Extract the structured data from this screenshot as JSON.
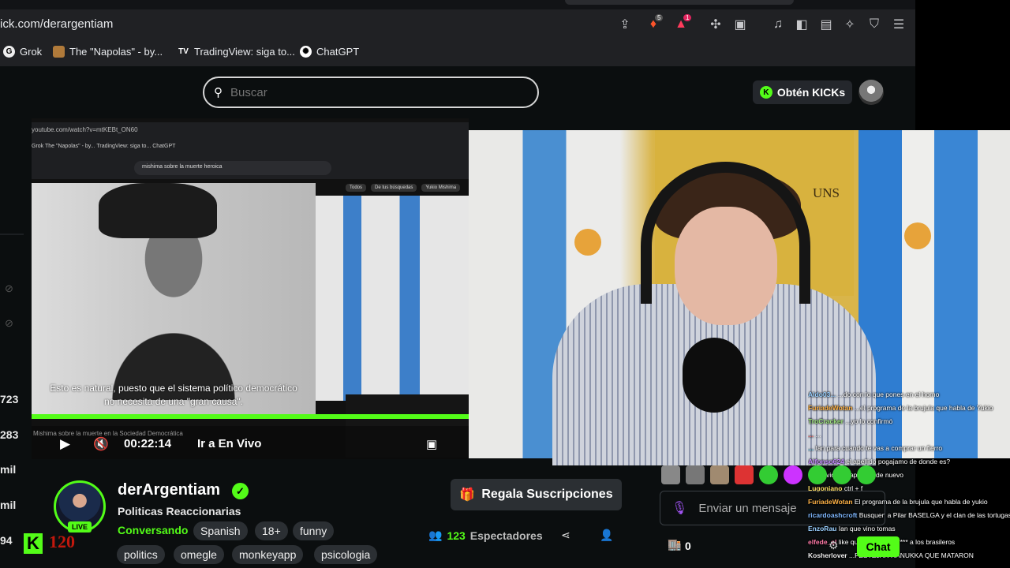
{
  "browser": {
    "url": "ick.com/derargentiam",
    "bookmarks": [
      {
        "label": "Grok",
        "icon": "grok-icon"
      },
      {
        "label": "The \"Napolas\" - by...",
        "icon": "substack-icon"
      },
      {
        "label": "TradingView: siga to...",
        "icon": "tradingview-icon"
      },
      {
        "label": "ChatGPT",
        "icon": "chatgpt-icon"
      }
    ],
    "brave_badge": "5",
    "rewards_badge": "1"
  },
  "header": {
    "search_placeholder": "Buscar",
    "kicks_button": "Obtén KICKs"
  },
  "sidebar": {
    "counts": [
      "723",
      "283",
      "mil",
      "mil",
      "94"
    ]
  },
  "inner_capture": {
    "url": "youtube.com/watch?v=mtKEBt_ON60",
    "bookmarks": "Grok   The \"Napolas\" - by...   TradingView: siga to...   ChatGPT",
    "search_query": "mishima sobre la muerte heroica",
    "chips": [
      "Todos",
      "De tus búsquedas",
      "Yukio Mishima"
    ],
    "subtitle_line1": "Esto es natural, puesto que el sistema político democrático",
    "subtitle_line2": "no necesita de una \"gran causa\".",
    "video_title": "Mishima sobre la muerte en la Sociedad Democrática"
  },
  "player": {
    "time": "00:22:14",
    "go_live": "Ir a En Vivo"
  },
  "webcam": {
    "banner_text": "UNS"
  },
  "chat": {
    "messages": [
      {
        "user": "Aldo03...",
        "text": "...do con lo que pones en el horno",
        "color": "#9ad0ff"
      },
      {
        "user": "FuriadeWotan",
        "text": "...el programa de la brujula que habla de Yukio",
        "color": "#ffb347"
      },
      {
        "user": "TroCracker",
        "text": "...yo lo confirmó",
        "color": "#9be37a"
      },
      {
        "user": "...",
        "text": "...",
        "color": "#ff6b6b"
      },
      {
        "user": "...",
        "text": "Ian para cuando te vas a comprar un fierro",
        "color": "#6bd6ff"
      },
      {
        "user": "Alfonso624",
        "text": "el apellido pogajamo de donde es?",
        "color": "#c58cff"
      },
      {
        "user": "...",
        "text": "...olvio que aparece de nuevo",
        "color": "#53fc18"
      },
      {
        "user": "Lugoniano",
        "text": "ctrl + f",
        "color": "#ffe066"
      },
      {
        "user": "FuriadeWotan",
        "text": "El programa de la brujula que habla de yukio",
        "color": "#ffb347"
      },
      {
        "user": "ricardoashcroft",
        "text": "Busquen a Pilar BASELGA y el clan de las tortugas",
        "color": "#7fb8ff"
      },
      {
        "user": "EnzoRau",
        "text": "Ian que vino tomas",
        "color": "#9ad0ff"
      },
      {
        "user": "elfede_el",
        "text": "like que van hacer ***** a los brasileros",
        "color": "#ff7aa8"
      },
      {
        "user": "Kosherlover",
        "text": "...FESTEJAR HANUKKA QUE MATARON",
        "color": "#f0f0f0"
      }
    ],
    "input_placeholder": "Enviar un mensaje",
    "send_label": "Chat",
    "store_count": "0"
  },
  "channel": {
    "name": "derArgentiam",
    "title": "Politicas Reaccionarias",
    "category": "Conversando",
    "tags": [
      "Spanish",
      "18+",
      "funny",
      "politics",
      "omegle",
      "monkeyapp",
      "psicologia"
    ],
    "live_label": "LIVE",
    "gift_button": "Regala Suscripciones",
    "viewer_count": "123",
    "viewer_label": "Espectadores",
    "overlay_number": "120"
  },
  "colors": {
    "accent": "#53fc18",
    "background": "#0b0e0f"
  }
}
